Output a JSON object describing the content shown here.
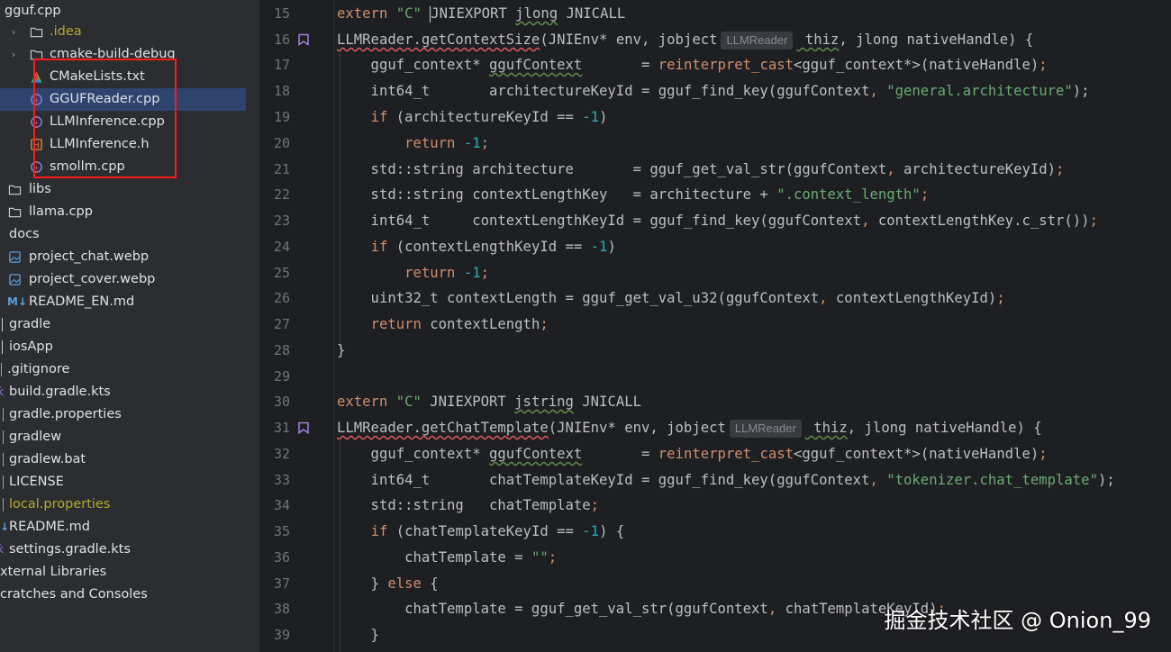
{
  "project_tree": {
    "items": [
      {
        "label": "gguf.cpp",
        "icon": "file-cpp-icon"
      },
      {
        "label": ".idea",
        "icon": "folder-icon"
      },
      {
        "label": "cmake-build-debug",
        "icon": "folder-icon"
      },
      {
        "label": "CMakeLists.txt",
        "icon": "cmake-icon"
      },
      {
        "label": "GGUFReader.cpp",
        "icon": "file-cpp-icon"
      },
      {
        "label": "LLMInference.cpp",
        "icon": "file-cpp-icon"
      },
      {
        "label": "LLMInference.h",
        "icon": "file-h-icon"
      },
      {
        "label": "smollm.cpp",
        "icon": "file-cpp-icon"
      },
      {
        "label": "libs",
        "icon": "folder-icon"
      },
      {
        "label": "llama.cpp",
        "icon": "folder-icon"
      },
      {
        "label": "docs",
        "icon": "folder-icon"
      },
      {
        "label": "project_chat.webp",
        "icon": "image-file-icon"
      },
      {
        "label": "project_cover.webp",
        "icon": "image-file-icon"
      },
      {
        "label": "README_EN.md",
        "icon": "markdown-icon"
      },
      {
        "label": "gradle",
        "icon": "folder-icon"
      },
      {
        "label": "iosApp",
        "icon": "folder-icon"
      },
      {
        "label": ".gitignore",
        "icon": "folder-icon"
      },
      {
        "label": "build.gradle.kts",
        "icon": "gradle-icon"
      },
      {
        "label": "gradle.properties",
        "icon": "gradle-icon"
      },
      {
        "label": "gradlew",
        "icon": "gradle-icon"
      },
      {
        "label": "gradlew.bat",
        "icon": "gradle-icon"
      },
      {
        "label": "LICENSE",
        "icon": "gradle-icon"
      },
      {
        "label": "local.properties",
        "icon": "gradle-icon"
      },
      {
        "label": "README.md",
        "icon": "gradle-icon"
      },
      {
        "label": "settings.gradle.kts",
        "icon": "gradle-icon"
      },
      {
        "label": "xternal Libraries",
        "icon": "gradle-icon"
      },
      {
        "label": "cratches and Consoles",
        "icon": "gradle-icon"
      }
    ],
    "markdown_badge": "M↓",
    "markdown_badge_small": "↓"
  },
  "editor": {
    "inlay_hint": "LLMReader",
    "line_numbers": [
      "15",
      "16",
      "17",
      "18",
      "19",
      "20",
      "21",
      "22",
      "23",
      "24",
      "25",
      "26",
      "27",
      "28",
      "29",
      "30",
      "31",
      "32",
      "33",
      "34",
      "35",
      "36",
      "37",
      "38",
      "39"
    ],
    "l15": {
      "a": "extern ",
      "b": "\"C\"",
      "c": " ",
      "d": "JNIEXPORT ",
      "e": "jlong",
      "f": " JNICALL"
    },
    "l16": {
      "a": "LLMReader.getContextSize",
      "b": "(JNIEnv* env, jobject",
      "c": " thiz",
      "d": ", jlong nativeHandle) {"
    },
    "l17": {
      "a": "    gguf_context* ",
      "b": "ggufContext",
      "c": "       = ",
      "d": "reinterpret_cast",
      "e": "<gguf_context*>(nativeHandle)",
      "f": ";"
    },
    "l18": {
      "a": "    int64_t       architectureKeyId = gguf_find_key(ggufContext",
      "b": ", ",
      "c": "\"general.architecture\"",
      "d": ");"
    },
    "l19": {
      "a": "    ",
      "b": "if",
      " c": " (architectureKeyId == ",
      "d": "-1",
      ")": ")"
    },
    "l20": {
      "a": "        ",
      "b": "return ",
      "c": "-1",
      ";": ";"
    },
    "l21": {
      "a": "    std::string architecture       = gguf_get_val_str(ggufContext",
      ",": ", ",
      "b": "architectureKeyId)",
      ";": ";"
    },
    "l22": {
      "a": "    std::string contextLengthKey   = architecture + ",
      "b": "\".context_length\"",
      ";": ";"
    },
    "l23": {
      "a": "    int64_t     contextLengthKeyId = gguf_find_key(ggufContext",
      ",": ", ",
      "b": "contextLengthKey.c_str())",
      ";": ";"
    },
    "l24": {
      "a": "    ",
      "b": "if",
      " c": " (contextLengthKeyId == ",
      "d": "-1",
      ")": ")"
    },
    "l25": {
      "a": "        ",
      "b": "return ",
      "c": "-1",
      ";": ";"
    },
    "l26": {
      "a": "    uint32_t contextLength = gguf_get_val_u32(ggufContext",
      ",": ", ",
      "b": "contextLengthKeyId)",
      ";": ";"
    },
    "l27": {
      "a": "    ",
      "b": "return ",
      "c": "contextLength",
      ";": ";"
    },
    "l28": {
      "a": "}"
    },
    "l29": {
      "a": ""
    },
    "l30": {
      "a": "extern ",
      "b": "\"C\"",
      "c": " JNIEXPORT ",
      "d": "jstring",
      " e": " JNICALL"
    },
    "l31": {
      "a": "LLMReader.getChatTemplate",
      "b": "(JNIEnv* env, jobject",
      "c": " thiz",
      "d": ", jlong nativeHandle) {"
    },
    "l32": {
      "a": "    gguf_context* ",
      "b": "ggufContext",
      "c": "       = ",
      "d": "reinterpret_cast",
      "e": "<gguf_context*>(nativeHandle)",
      "f": ";"
    },
    "l33": {
      "a": "    int64_t       chatTemplateKeyId = gguf_find_key(ggufContext",
      ",": ", ",
      "b": "\"tokenizer.chat_template\"",
      "c": ");"
    },
    "l34": {
      "a": "    std::string   chatTemplate",
      ";": ";"
    },
    "l35": {
      "a": "    ",
      "b": "if",
      " c": " (chatTemplateKeyId == ",
      "d": "-1",
      "e": ") {"
    },
    "l36": {
      "a": "        chatTemplate = ",
      "b": "\"\"",
      ";": ";"
    },
    "l37": {
      "a": "    } ",
      "b": "else ",
      "c": "{"
    },
    "l38": {
      "a": "        chatTemplate = gguf_get_val_str(ggufContext",
      ",": ", ",
      "b": "chatTemplateKeyId)",
      ";": ";"
    },
    "l39": {
      "a": "    }"
    }
  },
  "watermark": "掘金技术社区 @ Onion_99",
  "colors": {
    "highlight_box": "#ff1a1a",
    "selected_row": "#2e436e",
    "keyword": "#cf8e6d",
    "string": "#6aab73",
    "number": "#2aacb8"
  }
}
